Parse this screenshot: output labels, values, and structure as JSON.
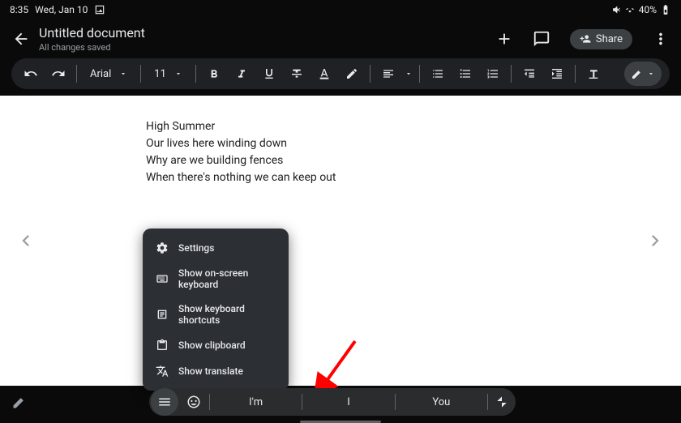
{
  "status": {
    "time": "8:35",
    "date": "Wed, Jan 10",
    "battery": "40%"
  },
  "header": {
    "title": "Untitled document",
    "subtitle": "All changes saved",
    "share_label": "Share"
  },
  "toolbar": {
    "font_name": "Arial",
    "font_size": "11"
  },
  "document": {
    "lines": [
      "High Summer",
      "Our lives here winding down",
      "Why are we building fences",
      "When there's nothing we can keep out"
    ]
  },
  "popup": {
    "items": [
      {
        "icon": "gear",
        "label": "Settings"
      },
      {
        "icon": "keyboard",
        "label": "Show on-screen keyboard"
      },
      {
        "icon": "shortcuts",
        "label": "Show keyboard shortcuts"
      },
      {
        "icon": "clipboard",
        "label": "Show clipboard"
      },
      {
        "icon": "translate",
        "label": "Show translate"
      }
    ]
  },
  "suggestions": {
    "w1": "I'm",
    "w2": "I",
    "w3": "You"
  }
}
